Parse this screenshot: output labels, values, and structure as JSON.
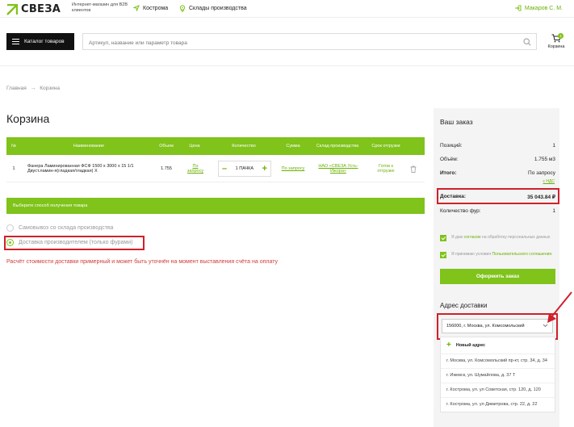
{
  "header": {
    "logo_text": "СВЕЗА",
    "tagline": "Интернет-магазин для B2B клиентов",
    "city": "Кострома",
    "warehouses": "Склады производства",
    "user": "Макаров С. М."
  },
  "search": {
    "catalog_label": "Каталог товаров",
    "placeholder": "Артикул, название или параметр товара"
  },
  "cart": {
    "label": "Корзина",
    "count": "1"
  },
  "breadcrumbs": {
    "home": "Главная",
    "separator": "→",
    "current": "Корзина"
  },
  "page_title": "Корзина",
  "table": {
    "headers": {
      "num": "№",
      "name": "Наименование",
      "volume": "Объем",
      "price": "Цена",
      "quantity": "Количество",
      "sum": "Сумма",
      "warehouse": "Склад производства",
      "ship": "Срок отгрузки"
    },
    "row": {
      "num": "1",
      "name": "Фанера Ламинированная ФСФ 1500 x 3000 x 15 1/1 Двуст.ламин-я(гладкая/гладкая) Х",
      "volume": "1.755",
      "price": "По запросу",
      "quantity": "1 ПАЧКА",
      "sum": "По запросу",
      "warehouse": "НАО «СВЕЗА Усть-Ижора»",
      "ship": "Готов к отгрузке"
    }
  },
  "delivery_method": {
    "title": "Выберите способ получения товара",
    "option_pickup": "Самовывоз со склада производства",
    "option_delivery": "Доставка производителем (только фурами)",
    "note": "Расчёт стоимости доставки примерный и может быть уточнён на момент выставления счёта на оплату"
  },
  "order": {
    "title": "Ваш заказ",
    "vat": "с НДС",
    "positions_label": "Позиций:",
    "positions_value": "1",
    "volume_label": "Объём:",
    "volume_value": "1.755 м3",
    "total_label": "Итого:",
    "total_value": "По запросу",
    "delivery_label": "Доставка:",
    "delivery_value": "35 043.84 ₽",
    "trucks_label": "Количество фур:",
    "trucks_value": "1",
    "consent_1_pre": "Я даю ",
    "consent_1_link": "согласие",
    "consent_1_post": " на обработку персональных данных",
    "consent_2_pre": "Я принимаю условия ",
    "consent_2_link": "Пользовательского соглашения.",
    "submit": "Оформить заказ"
  },
  "address": {
    "title": "Адрес доставки",
    "selected": "156000, г. Москва, ул. Комсомольский",
    "new_label": "Новый адрес",
    "items": [
      "г. Москва, ул. Комсомольский пр-кт, стр. 34, д. 34",
      "г. Ижевск, ул. Шумайлова, д. 37 Т",
      "г. Кострома, ул. ул Советская, стр. 120, д. 120",
      "г. Кострома, ул. ул Димитрова, стр. 22, д. 22"
    ]
  },
  "colors": {
    "accent": "#7fc31b",
    "highlight": "#d0202a",
    "dark": "#111111"
  }
}
